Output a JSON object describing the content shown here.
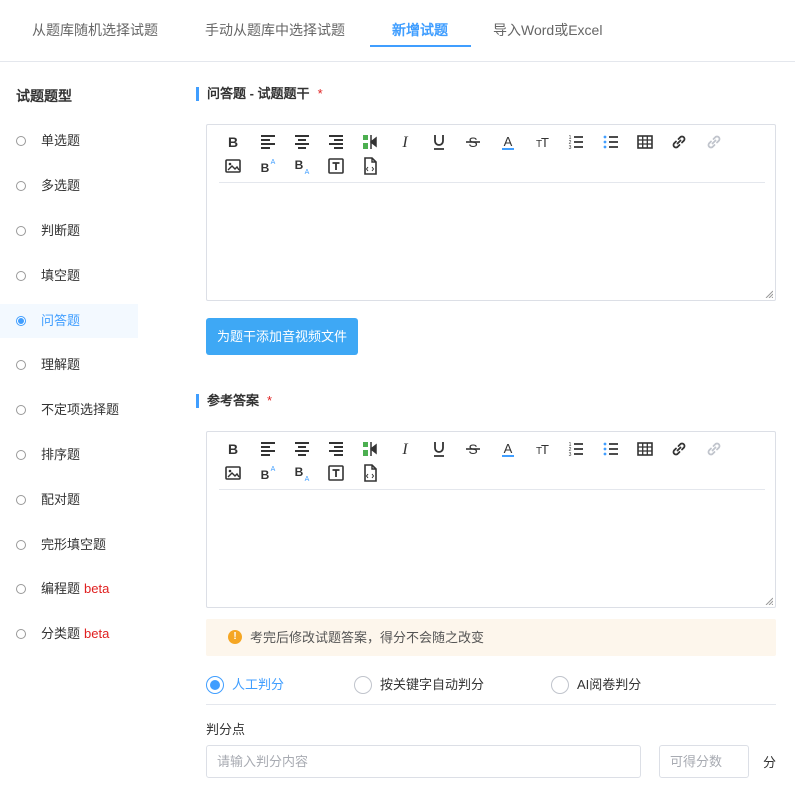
{
  "tabs": [
    {
      "label": "从题库随机选择试题"
    },
    {
      "label": "手动从题库中选择试题"
    },
    {
      "label": "新增试题"
    },
    {
      "label": "导入Word或Excel"
    }
  ],
  "active_tab": 2,
  "accent_color": "#409eff",
  "sidebar": {
    "title": "试题题型",
    "items": [
      {
        "label": "单选题"
      },
      {
        "label": "多选题"
      },
      {
        "label": "判断题"
      },
      {
        "label": "填空题"
      },
      {
        "label": "问答题"
      },
      {
        "label": "理解题"
      },
      {
        "label": "不定项选择题"
      },
      {
        "label": "排序题"
      },
      {
        "label": "配对题"
      },
      {
        "label": "完形填空题"
      },
      {
        "label": "编程题",
        "badge": "beta"
      },
      {
        "label": "分类题",
        "badge": "beta"
      }
    ],
    "selected_index": 4
  },
  "stem": {
    "title": "问答题 - 试题题干",
    "required_mark": "*",
    "add_media_label": "为题干添加音视频文件"
  },
  "answer": {
    "title": "参考答案",
    "required_mark": "*"
  },
  "toolbar_icons": [
    "bold-icon",
    "align-left-icon",
    "align-center-icon",
    "align-right-icon",
    "indent-icon",
    "italic-icon",
    "underline-icon",
    "strikethrough-icon",
    "font-color-icon",
    "font-size-icon",
    "ordered-list-icon",
    "bullet-list-icon",
    "table-icon",
    "link-icon",
    "unlink-icon",
    "image-icon",
    "superscript-icon",
    "subscript-icon",
    "textbox-icon",
    "file-icon"
  ],
  "notice": {
    "text": "考完后修改试题答案，得分不会随之改变"
  },
  "grading": {
    "options": [
      {
        "label": "人工判分"
      },
      {
        "label": "按关键字自动判分"
      },
      {
        "label": "AI阅卷判分"
      }
    ],
    "selected_index": 0
  },
  "points": {
    "label": "判分点",
    "content_placeholder": "请输入判分内容",
    "score_placeholder": "可得分数",
    "unit": "分"
  }
}
